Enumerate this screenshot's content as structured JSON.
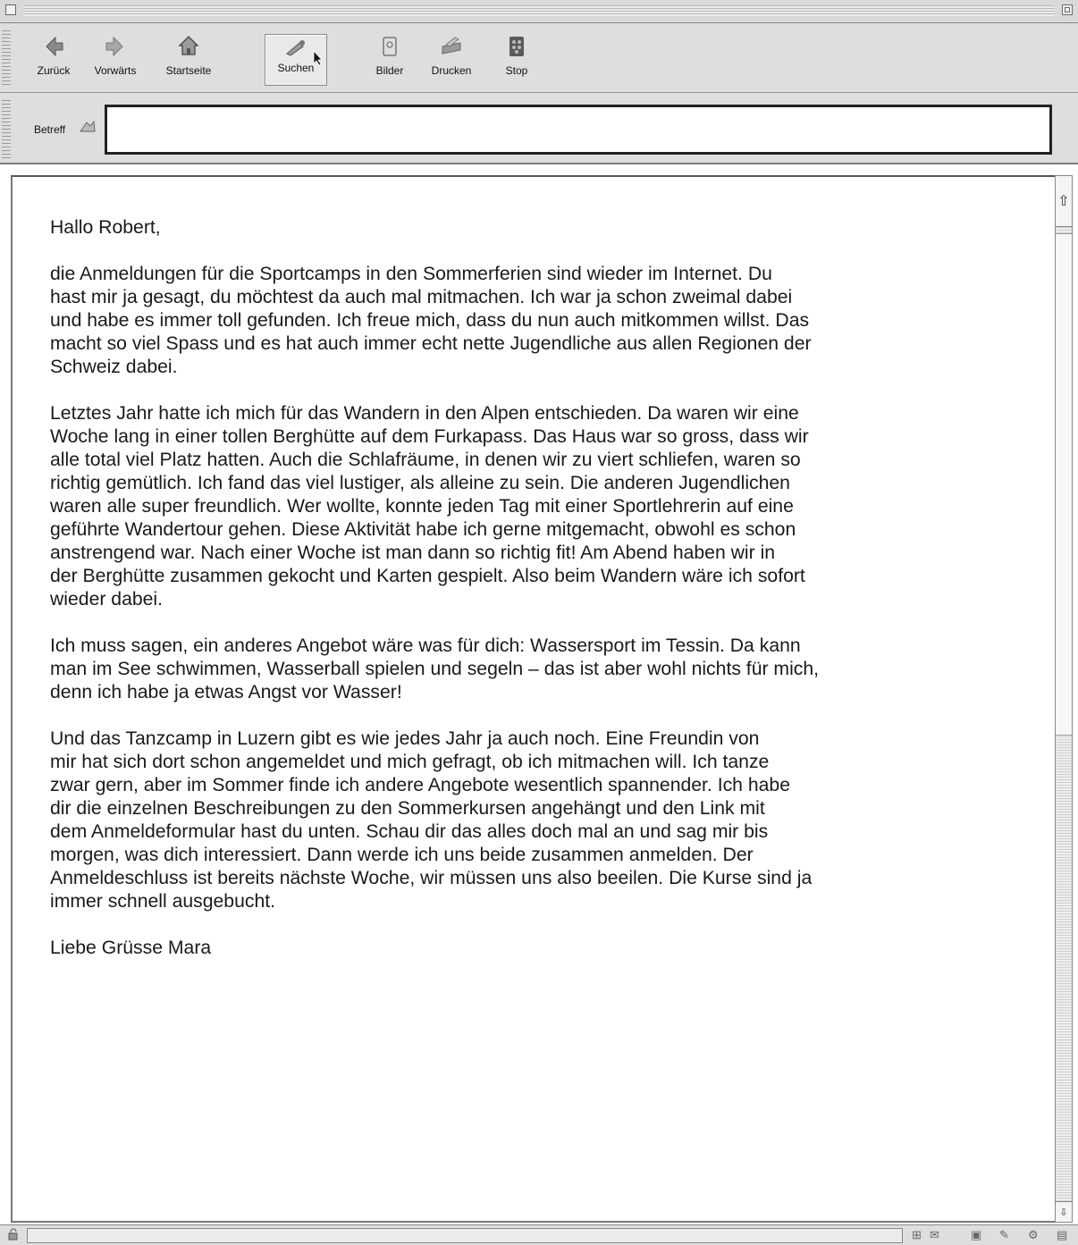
{
  "toolbar": {
    "buttons": [
      {
        "label": "Zurück",
        "icon": "back-arrow-icon"
      },
      {
        "label": "Vorwärts",
        "icon": "forward-arrow-icon"
      },
      {
        "label": "Startseite",
        "icon": "home-icon"
      },
      {
        "label": "Suchen",
        "icon": "search-icon",
        "active": true
      },
      {
        "label": "Bilder",
        "icon": "images-icon"
      },
      {
        "label": "Drucken",
        "icon": "printer-icon"
      },
      {
        "label": "Stop",
        "icon": "stop-icon"
      }
    ]
  },
  "address": {
    "label": "Betreff",
    "value": ""
  },
  "message": {
    "greeting": "Hallo Robert,",
    "paragraphs": [
      "die Anmeldungen für die Sportcamps in den Sommerferien sind wieder im Internet. Du\nhast mir ja gesagt, du möchtest da auch mal mitmachen. Ich war ja schon zweimal dabei\nund habe es immer toll gefunden. Ich freue mich, dass du nun auch mitkommen willst. Das\nmacht so viel Spass und es hat auch immer echt nette Jugendliche aus allen Regionen der\nSchweiz dabei.",
      "Letztes Jahr hatte ich mich für das Wandern in den Alpen entschieden. Da waren wir eine\nWoche lang in einer tollen Berghütte auf dem Furkapass. Das Haus war so gross, dass wir\nalle total viel Platz hatten. Auch die Schlafräume, in denen wir zu viert schliefen, waren so\nrichtig gemütlich. Ich fand das viel lustiger, als alleine zu sein. Die anderen Jugendlichen\nwaren alle super freundlich. Wer wollte, konnte jeden Tag mit einer Sportlehrerin auf eine\ngeführte Wandertour gehen. Diese Aktivität habe ich gerne mitgemacht, obwohl es schon\nanstrengend war. Nach einer Woche ist man dann so richtig fit! Am Abend haben wir in\nder Berghütte zusammen gekocht und Karten gespielt. Also beim Wandern wäre ich sofort\nwieder dabei.",
      "Ich muss sagen, ein anderes Angebot wäre was für dich: Wassersport im Tessin. Da kann\nman im See schwimmen, Wasserball spielen und segeln – das ist aber wohl nichts für mich,\ndenn ich habe ja etwas Angst vor Wasser!",
      "Und das Tanzcamp in Luzern gibt es wie jedes Jahr ja auch noch. Eine Freundin von\nmir hat sich dort schon angemeldet und mich gefragt, ob ich mitmachen will. Ich tanze\nzwar gern, aber im Sommer finde ich andere Angebote wesentlich spannender. Ich habe\ndir die einzelnen Beschreibungen zu den Sommerkursen angehängt und den Link mit\ndem Anmeldeformular hast du unten. Schau dir das alles doch mal an und sag mir bis\nmorgen, was dich interessiert. Dann werde ich uns beide zusammen anmelden. Der\nAnmeldeschluss ist bereits nächste Woche, wir müssen uns also beeilen. Die Kurse sind ja\nimmer schnell ausgebucht."
    ],
    "closing": "Liebe Grüsse  Mara"
  },
  "status": {
    "icons": [
      "lock-icon",
      "network-icon",
      "mail-icon",
      "chat-icon",
      "compose-icon",
      "page-icon"
    ]
  }
}
